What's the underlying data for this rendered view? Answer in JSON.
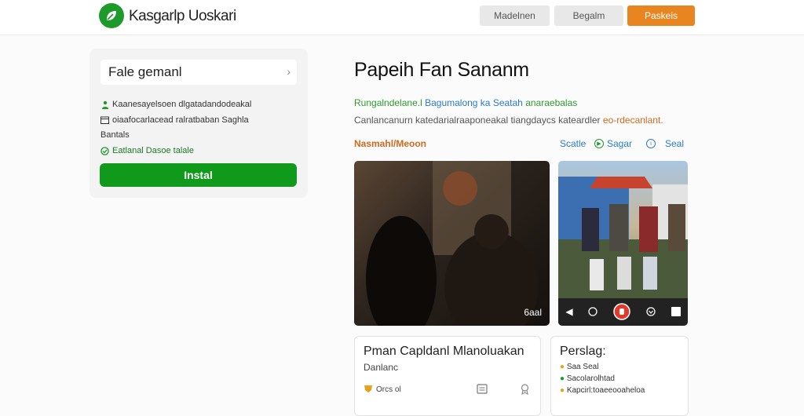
{
  "header": {
    "brand": "Kasgarlp Uoskari",
    "buttons": [
      "Madelnen",
      "Begalm",
      "Paskeis"
    ]
  },
  "sidebar": {
    "select_label": "Fale gemanl",
    "rows": [
      {
        "icon": "person-icon",
        "text": "Kaanesayelsoen dlgatadandodeakal"
      },
      {
        "icon": "calendar-icon",
        "text": "oiaafocarlacead ralratbaban Saghla"
      },
      {
        "icon": "",
        "text": "Bantals"
      },
      {
        "icon": "check-circle-icon",
        "text": "Eatlanal Dasoe talale"
      }
    ],
    "install_label": "Instal"
  },
  "main": {
    "title": "Papeih Fan Sananm",
    "subtitle_green": "Rungalndelane.l",
    "subtitle_blue": "Bagumalong ka Seatah",
    "subtitle_rest": "anaraebalas",
    "description": "Canlancanurn katedarialraaponeakal tiangdaycs kateardler",
    "description_accent": "eo-rdecanlant.",
    "meta_left": "Nasmahl/Meoon",
    "meta_right": [
      {
        "icon": "",
        "label": "Scatle"
      },
      {
        "icon": "play-circle-icon",
        "label": "Sagar"
      },
      {
        "icon": "info-circle-icon",
        "label": "Seal"
      }
    ]
  },
  "media": {
    "video_time": "6aal"
  },
  "cards": [
    {
      "title": "Pman Capldanl Mlanoluakan",
      "subtitle": "Danlanc",
      "footer_text": "Orcs ol"
    },
    {
      "title": "Perslag:",
      "lines": [
        "Saa Seal",
        "Sacolarolhtad",
        "Kapcirl:toaeeooaheloa"
      ]
    }
  ],
  "colors": {
    "brand_green": "#1e9a2a",
    "install_green": "#0f9a1c",
    "accent_orange": "#e98520",
    "link_blue": "#2a7bd0"
  }
}
